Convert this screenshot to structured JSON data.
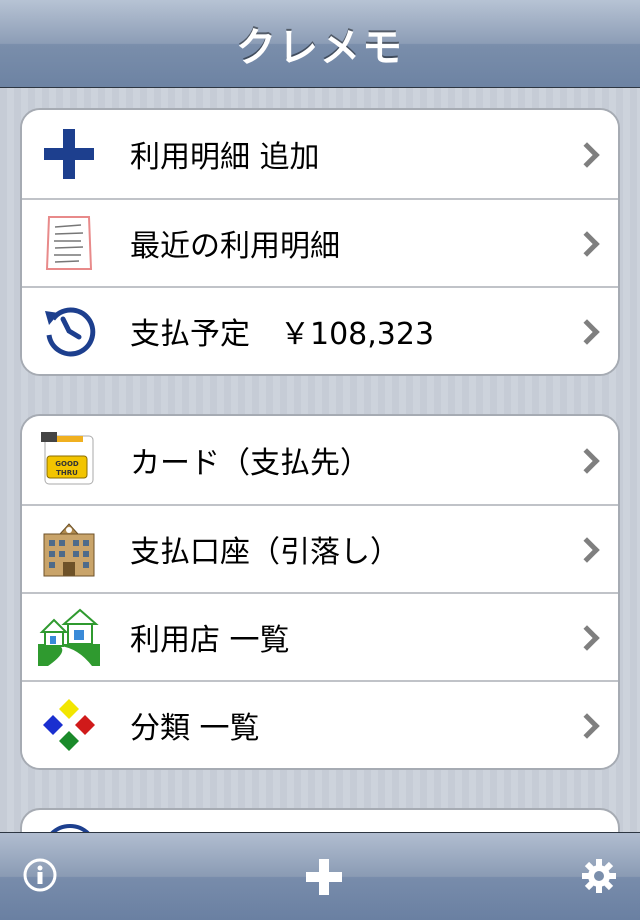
{
  "navbar": {
    "title": "クレメモ"
  },
  "group1": [
    {
      "label": "利用明細 追加",
      "icon": "plus-icon"
    },
    {
      "label": "最近の利用明細",
      "icon": "receipt-icon"
    },
    {
      "label": "支払予定　￥108,323",
      "icon": "clock-history-icon"
    }
  ],
  "group2": [
    {
      "label": "カード（支払先）",
      "icon": "credit-card-icon"
    },
    {
      "label": "支払口座（引落し）",
      "icon": "bank-building-icon"
    },
    {
      "label": "利用店 一覧",
      "icon": "shops-icon"
    },
    {
      "label": "分類 一覧",
      "icon": "category-diamonds-icon"
    }
  ],
  "toolbar": {
    "left": "info-icon",
    "center": "add-icon",
    "right": "settings-gear-icon"
  },
  "colors": {
    "plus": "#1d3f8e",
    "clock": "#1d3f8e",
    "card_yellow": "#f2c400",
    "bank": "#b08a4e",
    "shop_green": "#2f9a2f"
  }
}
